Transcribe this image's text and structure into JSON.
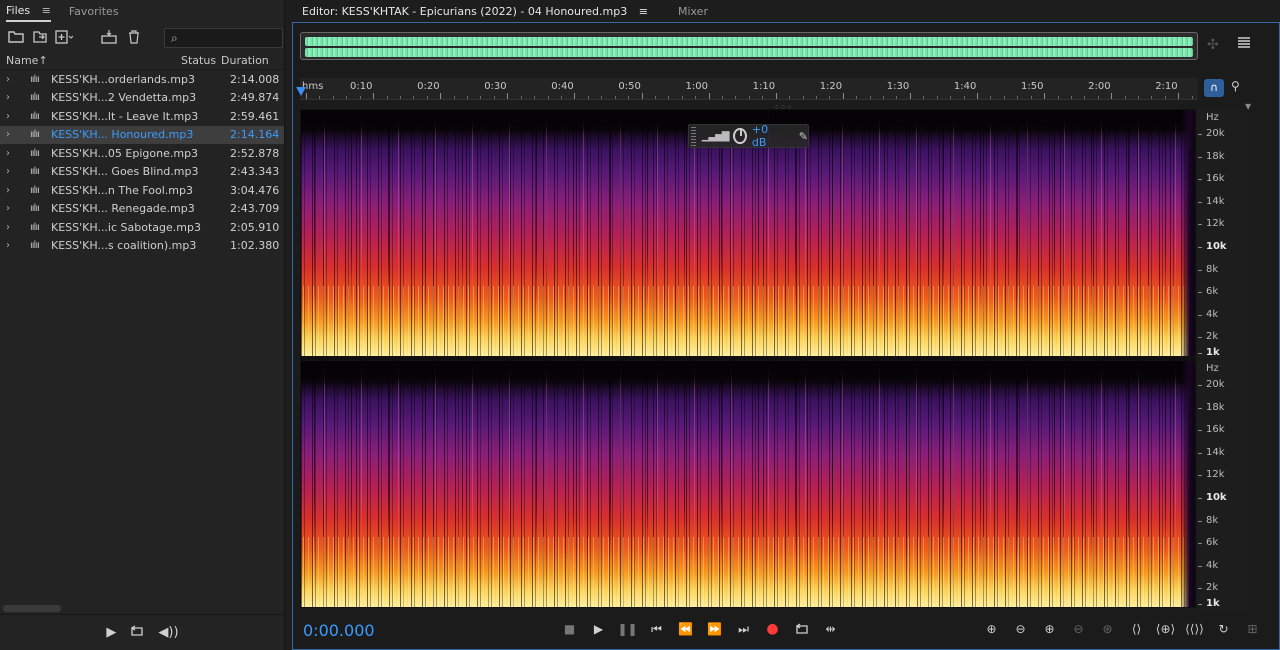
{
  "left_panel": {
    "tabs": [
      {
        "label": "Files",
        "active": true
      },
      {
        "label": "Favorites",
        "active": false
      }
    ],
    "toolbar_icons": [
      "open-file-icon",
      "import-icon",
      "new-file-icon",
      "insert-multitrack-icon",
      "trash-icon"
    ],
    "search": {
      "icon": "search-icon",
      "value": ""
    },
    "columns": {
      "name": "Name",
      "sort_indicator": "↑",
      "status": "Status",
      "duration": "Duration"
    },
    "files": [
      {
        "name": "KESS'KH...orderlands.mp3",
        "duration": "2:14.008",
        "selected": false
      },
      {
        "name": "KESS'KH...2 Vendetta.mp3",
        "duration": "2:49.874",
        "selected": false
      },
      {
        "name": "KESS'KH...lt - Leave It.mp3",
        "duration": "2:59.461",
        "selected": false
      },
      {
        "name": "KESS'KH... Honoured.mp3",
        "duration": "2:14.164",
        "selected": true
      },
      {
        "name": "KESS'KH...05 Epigone.mp3",
        "duration": "2:52.878",
        "selected": false
      },
      {
        "name": "KESS'KH... Goes Blind.mp3",
        "duration": "2:43.343",
        "selected": false
      },
      {
        "name": "KESS'KH...n The Fool.mp3",
        "duration": "3:04.476",
        "selected": false
      },
      {
        "name": "KESS'KH... Renegade.mp3",
        "duration": "2:43.709",
        "selected": false
      },
      {
        "name": "KESS'KH...ic Sabotage.mp3",
        "duration": "2:05.910",
        "selected": false
      },
      {
        "name": "KESS'KH...s coalition).mp3",
        "duration": "1:02.380",
        "selected": false
      }
    ]
  },
  "editor": {
    "tabs": [
      {
        "label": "Editor: KESS'KHTAK - Epicurians (2022) - 04 Honoured.mp3",
        "active": true
      },
      {
        "label": "Mixer",
        "active": false
      }
    ],
    "ruler": {
      "unit": "hms",
      "labels": [
        "0:10",
        "0:20",
        "0:30",
        "0:40",
        "0:50",
        "1:00",
        "1:10",
        "1:20",
        "1:30",
        "1:40",
        "1:50",
        "2:00",
        "2:10"
      ]
    },
    "hud": {
      "gain": "+0 dB"
    },
    "freq_scale": {
      "unit": "Hz",
      "labels": [
        "20k",
        "18k",
        "16k",
        "14k",
        "12k",
        "10k",
        "8k",
        "6k",
        "4k",
        "2k",
        "1k"
      ]
    },
    "timecode": "0:00.000",
    "accent_color": "#3b9cff",
    "record_color": "#ff3b3b",
    "waveform_color": "#7ce3ad"
  }
}
